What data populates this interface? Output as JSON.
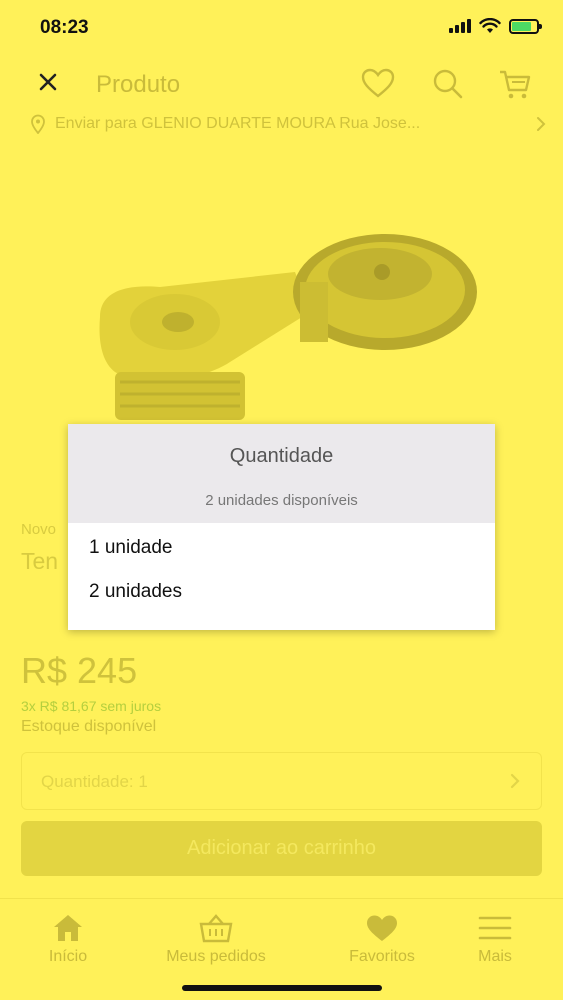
{
  "status_bar": {
    "time": "08:23"
  },
  "header": {
    "title": "Produto"
  },
  "shipping": {
    "text": "Enviar para GLENIO DUARTE MOURA Rua Jose..."
  },
  "product": {
    "condition": "Novo",
    "title_visible": "Ten",
    "price": "R$ 245",
    "installments": "3x R$ 81,67 sem juros",
    "stock": "Estoque disponível",
    "quantity_label": "Quantidade: 1",
    "add_to_cart": "Adicionar ao carrinho"
  },
  "modal": {
    "title": "Quantidade",
    "subtitle": "2 unidades disponíveis",
    "options": [
      "1 unidade",
      "2 unidades"
    ]
  },
  "tabbar": {
    "items": [
      {
        "label": "Início",
        "icon": "home-icon"
      },
      {
        "label": "Meus pedidos",
        "icon": "basket-icon"
      },
      {
        "label": "Favoritos",
        "icon": "heart-icon"
      },
      {
        "label": "Mais",
        "icon": "menu-icon"
      }
    ]
  },
  "colors": {
    "background": "#fff159",
    "modal_header": "#ebe9ec",
    "dimmed_text": "#cfc23c",
    "battery": "#4cd964"
  }
}
